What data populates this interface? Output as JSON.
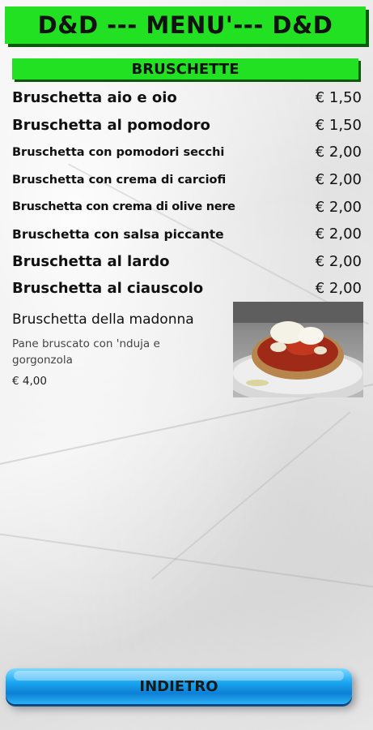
{
  "header": {
    "title": "D&D  --- MENU'---  D&D"
  },
  "section": {
    "title": "BRUSCHETTE"
  },
  "items": [
    {
      "name": "Bruschetta aio e oio",
      "price": "€ 1,50"
    },
    {
      "name": "Bruschetta al pomodoro",
      "price": "€ 1,50"
    },
    {
      "name": "Bruschetta con pomodori secchi",
      "price": "€ 2,00"
    },
    {
      "name": "Bruschetta con crema di carciofi",
      "price": "€ 2,00"
    },
    {
      "name": "Bruschetta con crema di olive nere",
      "price": "€ 2,00"
    },
    {
      "name": "Bruschetta con salsa piccante",
      "price": "€ 2,00"
    },
    {
      "name": "Bruschetta al lardo",
      "price": "€ 2,00"
    },
    {
      "name": "Bruschetta al ciauscolo",
      "price": "€ 2,00"
    }
  ],
  "special": {
    "name": "Bruschetta della madonna",
    "description": "Pane bruscato con 'nduja e gorgonzola",
    "price": "€ 4,00",
    "image_icon": "bruschetta-photo"
  },
  "footer": {
    "back_label": "INDIETRO"
  },
  "colors": {
    "header_green": "#22e022",
    "button_blue": "#1aa6f0"
  }
}
